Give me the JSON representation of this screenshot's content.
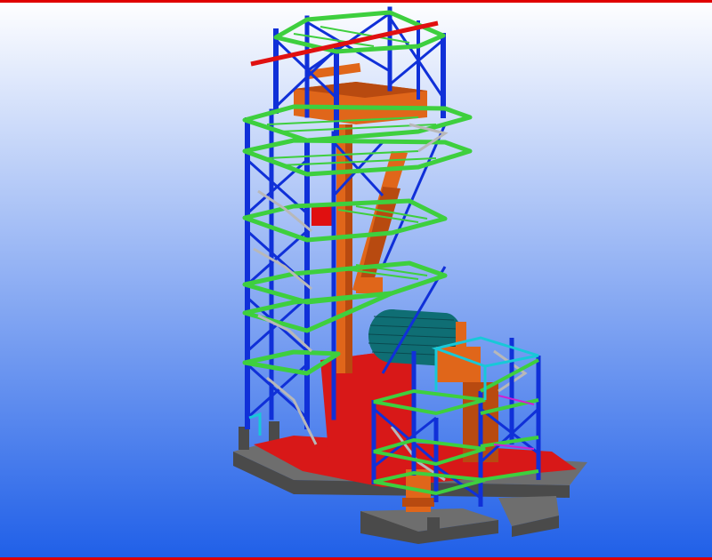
{
  "scene": {
    "subject": "steel-structure-3d-model",
    "colors": {
      "background_top": "#ffffff",
      "background_bottom": "#1f5fe8",
      "border": "#e00000",
      "column": "#1030d8",
      "beam": "#3ecf3e",
      "equipment": "#e0661a",
      "equipment_dark": "#b84a10",
      "base_block": "#d81818",
      "foundation": "#6e6e6e",
      "foundation_dark": "#4a4a4a",
      "cylinder": "#0f6e74",
      "stairs": "#b8b8b8",
      "accent_beam": "#e01010",
      "cyan": "#18c8d8",
      "magenta": "#d020d0"
    }
  }
}
